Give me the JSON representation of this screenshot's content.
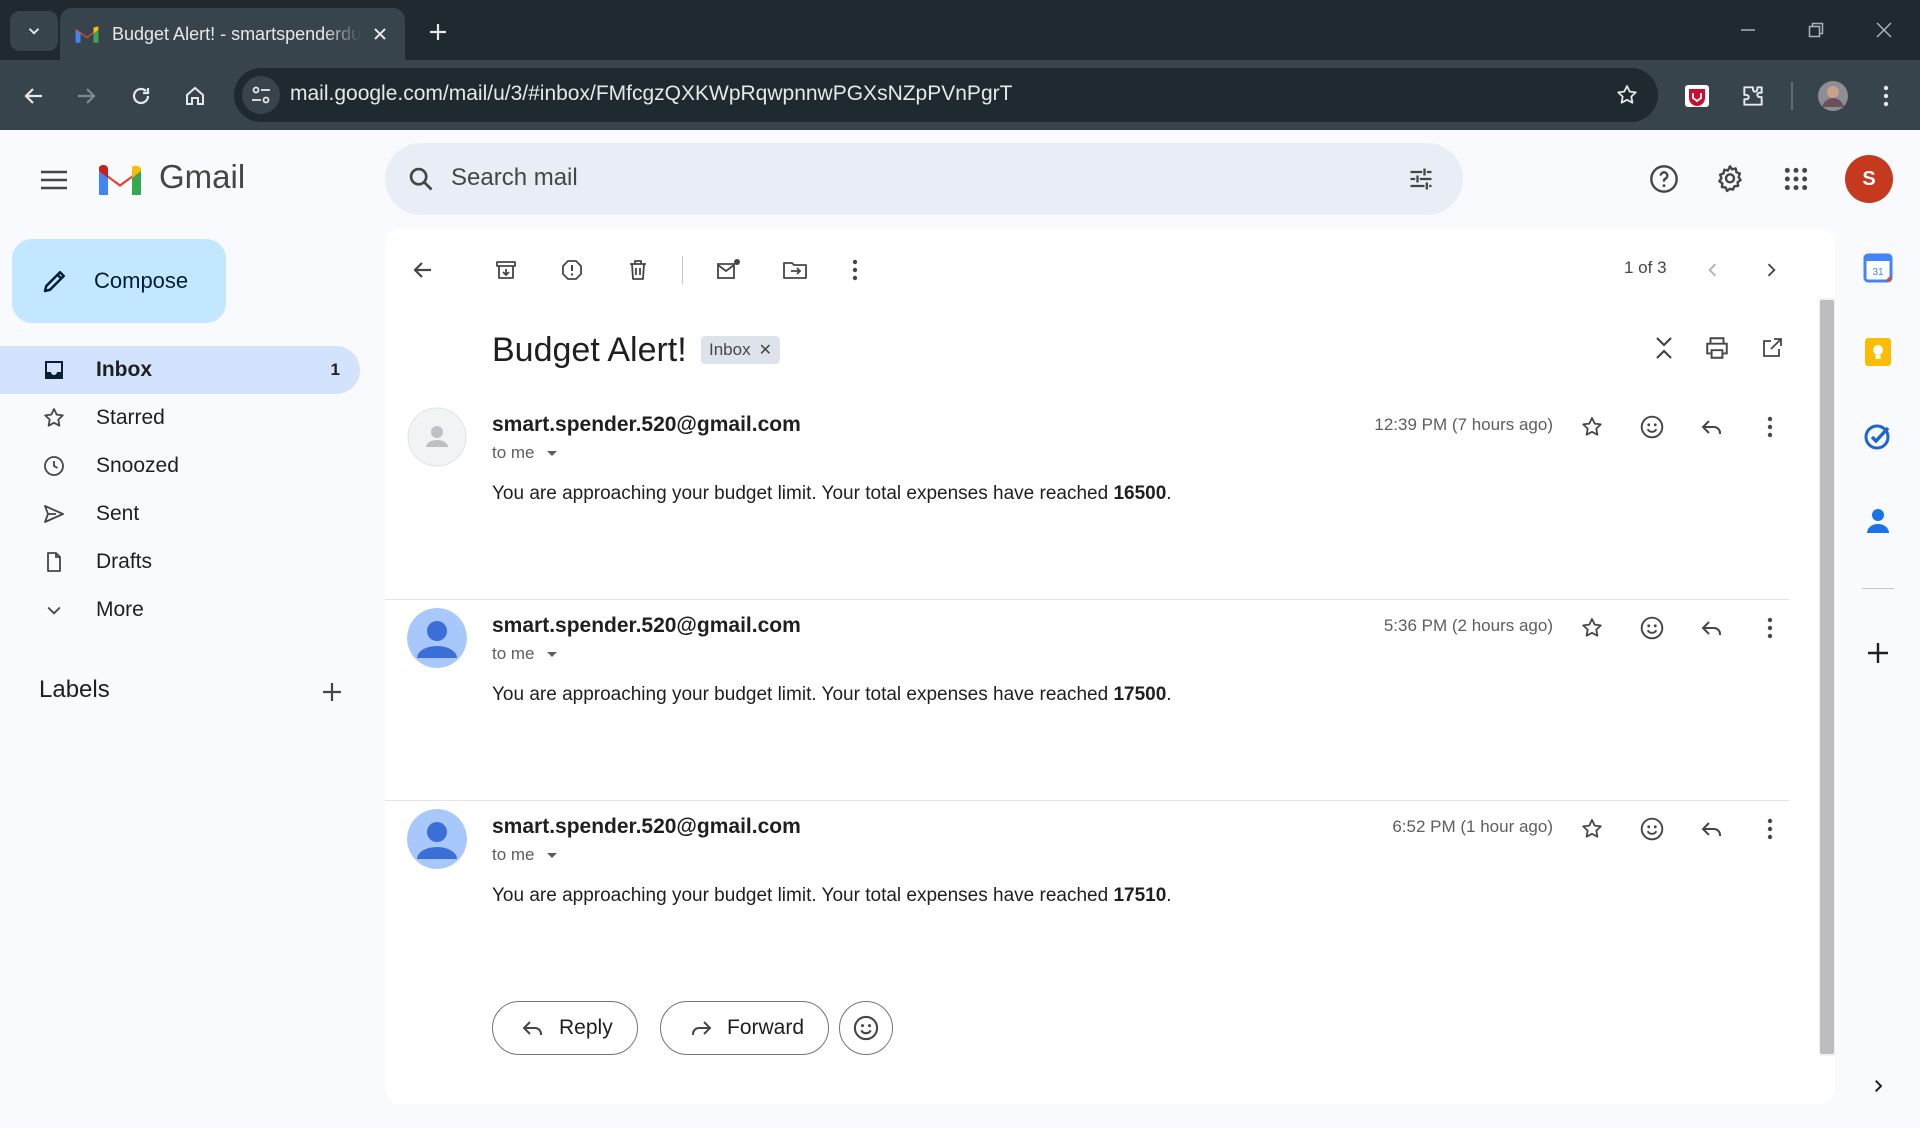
{
  "browser": {
    "tab_title": "Budget Alert! - smartspenderdu",
    "url": "mail.google.com/mail/u/3/#inbox/FMfcgzQXKWpRqwpnnwPGXsNZpPVnPgrT"
  },
  "gmail": {
    "product_name": "Gmail",
    "search_placeholder": "Search mail",
    "account_initial": "S"
  },
  "sidebar": {
    "compose_label": "Compose",
    "items": [
      {
        "label": "Inbox",
        "count": "1",
        "icon": "inbox-icon"
      },
      {
        "label": "Starred",
        "icon": "star-icon"
      },
      {
        "label": "Snoozed",
        "icon": "clock-icon"
      },
      {
        "label": "Sent",
        "icon": "send-icon"
      },
      {
        "label": "Drafts",
        "icon": "draft-icon"
      },
      {
        "label": "More",
        "icon": "chevron-down-icon"
      }
    ],
    "labels_title": "Labels"
  },
  "thread": {
    "pager": "1 of 3",
    "subject": "Budget Alert!",
    "label_chip": "Inbox",
    "messages": [
      {
        "sender": "smart.spender.520@gmail.com",
        "to": "to me",
        "time": "12:39 PM (7 hours ago)",
        "body_prefix": "You are approaching your budget limit. Your total expenses have reached ",
        "amount": "16500",
        "body_suffix": "."
      },
      {
        "sender": "smart.spender.520@gmail.com",
        "to": "to me",
        "time": "5:36 PM (2 hours ago)",
        "body_prefix": "You are approaching your budget limit. Your total expenses have reached ",
        "amount": "17500",
        "body_suffix": "."
      },
      {
        "sender": "smart.spender.520@gmail.com",
        "to": "to me",
        "time": "6:52 PM (1 hour ago)",
        "body_prefix": "You are approaching your budget limit. Your total expenses have reached ",
        "amount": "17510",
        "body_suffix": "."
      }
    ],
    "reply_label": "Reply",
    "forward_label": "Forward"
  },
  "colors": {
    "accent": "#0b57d0",
    "compose_bg": "#c2e7ff",
    "active_nav": "#d3e3fd",
    "avatar_bg": "#c5391f"
  }
}
